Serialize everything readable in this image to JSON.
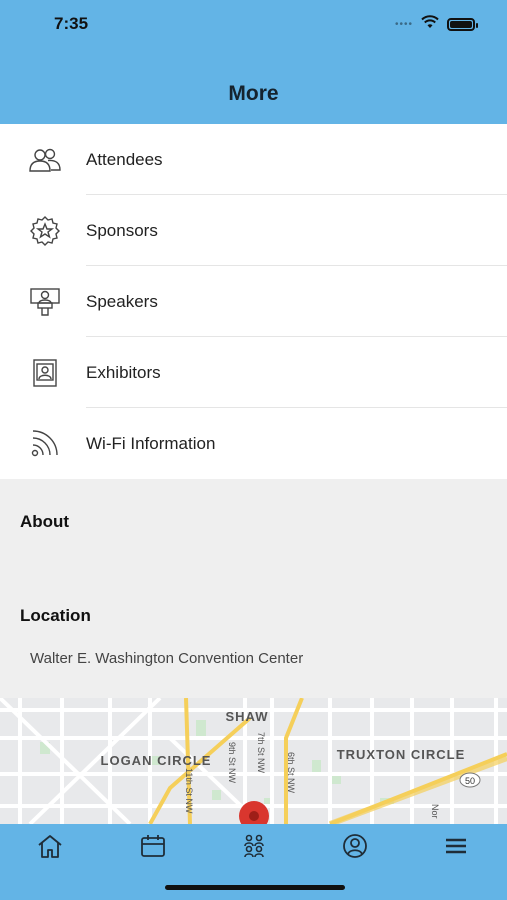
{
  "status_bar": {
    "time": "7:35"
  },
  "header": {
    "title": "More"
  },
  "menu": {
    "items": [
      {
        "label": "Attendees",
        "icon": "attendees-icon"
      },
      {
        "label": "Sponsors",
        "icon": "sponsor-badge-icon"
      },
      {
        "label": "Speakers",
        "icon": "speaker-podium-icon"
      },
      {
        "label": "Exhibitors",
        "icon": "exhibitor-booth-icon"
      },
      {
        "label": "Wi-Fi Information",
        "icon": "wifi-icon"
      }
    ]
  },
  "about": {
    "title": "About"
  },
  "location": {
    "title": "Location",
    "address": "Walter E. Washington Convention Center"
  },
  "map": {
    "labels": {
      "shaw": "SHAW",
      "logan_circle": "LOGAN CIRCLE",
      "truxton_circle": "TRUXTON CIRCLE",
      "street_9th": "9th St NW",
      "street_7th": "7th St NW",
      "street_6th": "6th St NW",
      "street_11th": "11th St NW",
      "route_50": "50",
      "north": "Nor"
    }
  },
  "tabbar": {
    "tabs": [
      {
        "icon": "home-icon"
      },
      {
        "icon": "calendar-icon"
      },
      {
        "icon": "people-icon"
      },
      {
        "icon": "profile-icon"
      },
      {
        "icon": "menu-icon"
      }
    ]
  },
  "colors": {
    "header": "#63b4e6",
    "tabbar": "#63b4e6",
    "map_pin": "#d9362e",
    "map_road": "#f5cf5a"
  }
}
